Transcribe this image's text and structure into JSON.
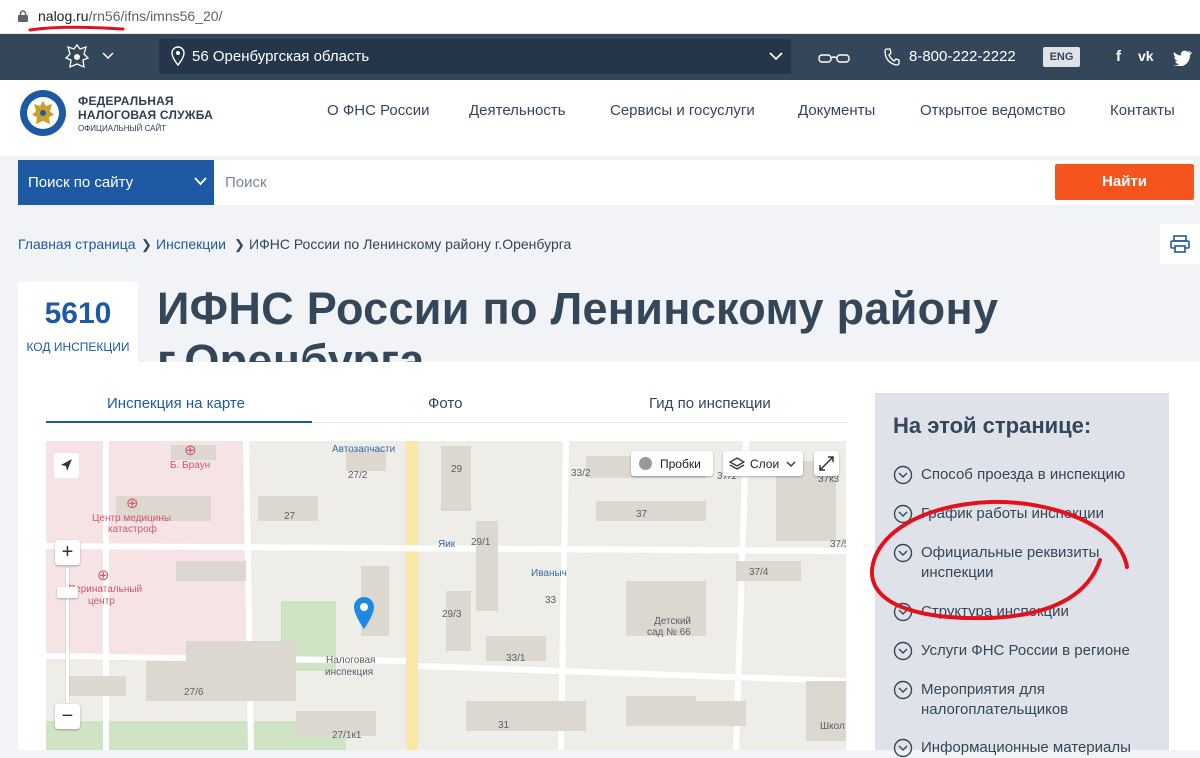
{
  "browser": {
    "url_host": "nalog.ru",
    "url_path": "/rn56/ifns/imns56_20/"
  },
  "topbar": {
    "region": "56 Оренбургская область",
    "phone": "8-800-222-2222",
    "lang": "ENG",
    "social": [
      "f",
      "vk",
      "tw"
    ]
  },
  "header": {
    "logo_line1": "ФЕДЕРАЛЬНАЯ",
    "logo_line2": "НАЛОГОВАЯ СЛУЖБА",
    "logo_line3": "ОФИЦИАЛЬНЫЙ САЙТ",
    "nav": [
      "О ФНС России",
      "Деятельность",
      "Сервисы и госуслуги",
      "Документы",
      "Открытое ведомство",
      "Контакты"
    ]
  },
  "search": {
    "scope": "Поиск по сайту",
    "placeholder": "Поиск",
    "button": "Найти"
  },
  "breadcrumbs": [
    "Главная страница",
    "Инспекции",
    "ИФНС России по Ленинскому району г.Оренбурга"
  ],
  "inspection": {
    "code": "5610",
    "code_label": "КОД ИНСПЕКЦИИ",
    "title": "ИФНС России по Ленинскому району г.Оренбурга"
  },
  "tabs": [
    "Инспекция на карте",
    "Фото",
    "Гид по инспекции"
  ],
  "map": {
    "traffic": "Пробки",
    "layers": "Слои",
    "zoom_in": "+",
    "zoom_out": "−",
    "labels": {
      "auto": "Автозапчасти",
      "braun": "Б. Браун",
      "med1": "Центр медицины",
      "med2": "катастроф",
      "peri1": "Перинатальный",
      "peri2": "центр",
      "yaik": "Яик",
      "ivanych": "Иваныч",
      "nal1": "Налоговая",
      "nal2": "инспекция",
      "kg1": "Детский",
      "kg2": "сад № 66",
      "school": "Школ",
      "b29": "29",
      "b27_2": "27/2",
      "b27": "27",
      "b33_2": "33/2",
      "b37_1": "37/1",
      "b37k3": "37к3",
      "b37": "37",
      "b29_1": "29/1",
      "b37_5": "37/5",
      "b37_4": "37/4",
      "b33": "33",
      "b29_3": "29/3",
      "b33_1": "33/1",
      "b27_6": "27/6",
      "b31": "31",
      "b27_1k1": "27/1к1"
    }
  },
  "sidebar": {
    "heading": "На этой странице:",
    "items": [
      "Способ проезда в инспекцию",
      "График работы инспекции",
      "Официальные реквизиты инспекции",
      "Структура инспекции",
      "Услуги ФНС России в регионе",
      "Мероприятия для налогоплательщиков",
      "Информационные материалы"
    ]
  }
}
